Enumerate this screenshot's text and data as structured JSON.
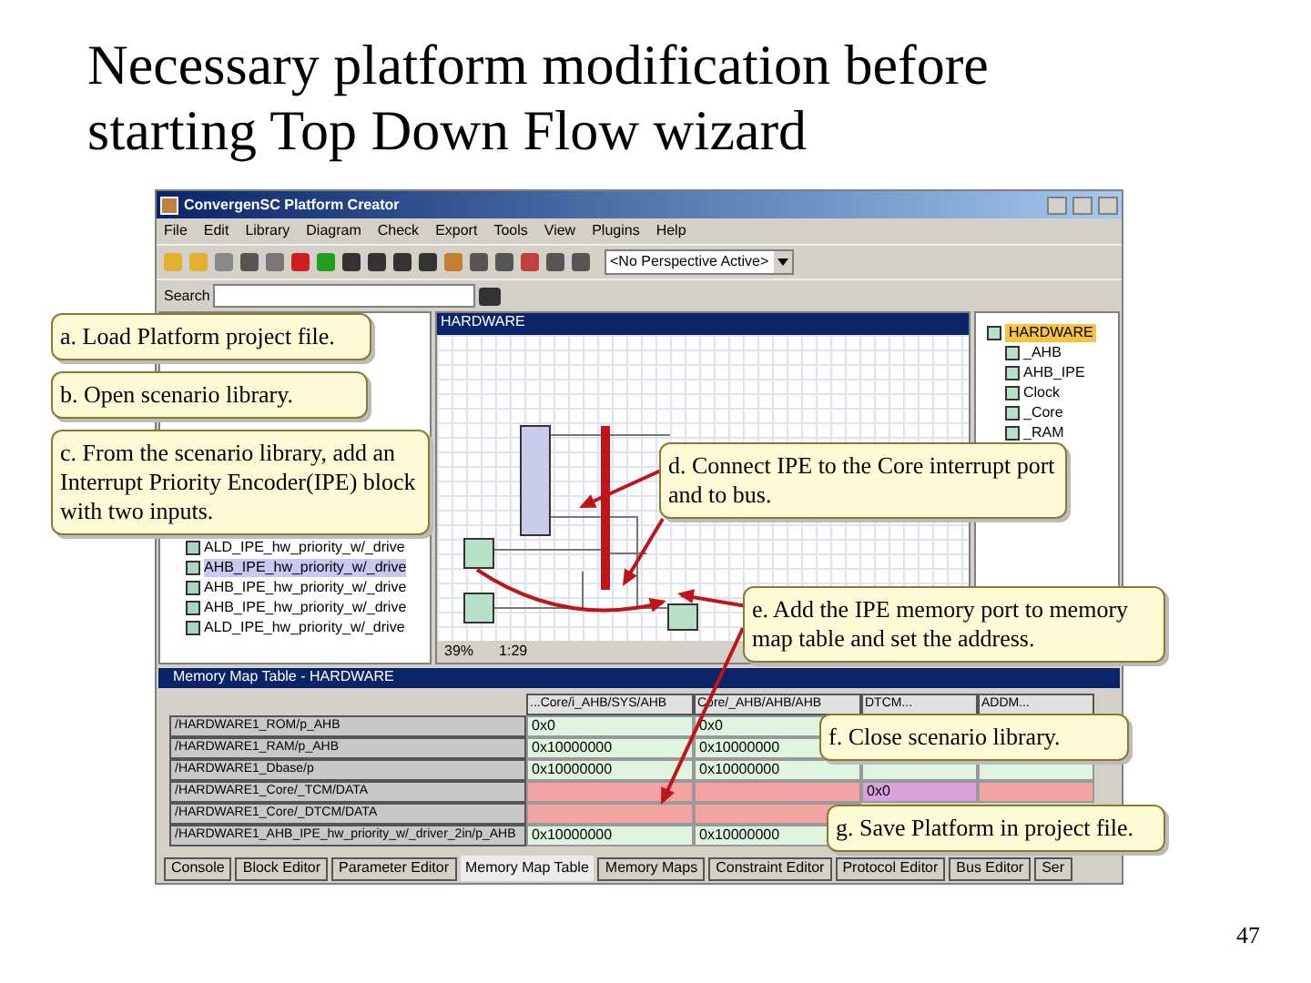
{
  "slide": {
    "title_lines": [
      "Necessary platform modification before",
      "starting Top Down Flow wizard"
    ],
    "page_number": "47"
  },
  "window": {
    "title": "ConvergenSC  Platform Creator",
    "menu": [
      "File",
      "Edit",
      "Library",
      "Diagram",
      "Check",
      "Export",
      "Tools",
      "View",
      "Plugins",
      "Help"
    ],
    "perspective": "<No Perspective Active>",
    "search_label": "Search",
    "library_items": [
      {
        "label": "ALD_IPE_hw_priority_w/_drive",
        "selected": false
      },
      {
        "label": "AHB_IPE_hw_priority_w/_drive",
        "selected": true
      },
      {
        "label": "AHB_IPE_hw_priority_w/_drive",
        "selected": false
      },
      {
        "label": "AHB_IPE_hw_priority_w/_drive",
        "selected": false
      },
      {
        "label": "ALD_IPE_hw_priority_w/_drive",
        "selected": false
      }
    ],
    "canvas": {
      "title": "HARDWARE",
      "zoom": "39%",
      "position": "1:29"
    },
    "hierarchy": {
      "label": "HARDWARE",
      "selected": true,
      "children": [
        {
          "label": "_AHB",
          "selected": false
        },
        {
          "label": "AHB_IPE",
          "selected": false
        },
        {
          "label": "Clock",
          "selected": false
        },
        {
          "label": "_Core",
          "selected": false
        },
        {
          "label": "_RAM",
          "selected": false
        }
      ]
    },
    "memory_map": {
      "title": "Memory Map Table - HARDWARE",
      "columns": [
        "...Core/i_AHB/SYS/AHB",
        "Core/_AHB/AHB/AHB",
        "DTCM...",
        "ADDM..."
      ],
      "rows": [
        {
          "name": "/HARDWARE1_ROM/p_AHB",
          "cells": [
            {
              "text": "0x0",
              "color": "#dff5df"
            },
            {
              "text": "0x0",
              "color": "#dff5df"
            }
          ]
        },
        {
          "name": "/HARDWARE1_RAM/p_AHB",
          "cells": [
            {
              "text": "0x10000000",
              "color": "#dff5df"
            },
            {
              "text": "0x10000000",
              "color": "#dff5df"
            }
          ]
        },
        {
          "name": "/HARDWARE1_Dbase/p",
          "cells": [
            {
              "text": "0x10000000",
              "color": "#dff5df"
            },
            {
              "text": "0x10000000",
              "color": "#dff5df"
            },
            {
              "color": "#dff5df"
            },
            {
              "color": "#dff5df"
            }
          ]
        },
        {
          "name": "/HARDWARE1_Core/_TCM/DATA",
          "cells": [
            {
              "color": "#f4a3a3"
            },
            {
              "color": "#f4a3a3"
            },
            {
              "text": "0x0",
              "color": "#d9a3d9"
            },
            {
              "color": "#f4a3a3"
            }
          ]
        },
        {
          "name": "/HARDWARE1_Core/_DTCM/DATA",
          "cells": [
            {
              "color": "#f4a3a3"
            },
            {
              "color": "#f4a3a3"
            }
          ]
        },
        {
          "name": "/HARDWARE1_AHB_IPE_hw_priority_w/_driver_2in/p_AHB",
          "cells": [
            {
              "text": "0x10000000",
              "color": "#dff5df"
            },
            {
              "text": "0x10000000",
              "color": "#dff5df"
            }
          ]
        }
      ]
    },
    "tabs": [
      {
        "label": "Console",
        "selected": false
      },
      {
        "label": "Block Editor",
        "selected": false
      },
      {
        "label": "Parameter Editor",
        "selected": false
      },
      {
        "label": "Memory Map Table",
        "selected": true
      },
      {
        "label": "Memory Maps",
        "selected": false
      },
      {
        "label": "Constraint Editor",
        "selected": false
      },
      {
        "label": "Protocol Editor",
        "selected": false
      },
      {
        "label": "Bus Editor",
        "selected": false
      },
      {
        "label": "Ser",
        "selected": false
      }
    ]
  },
  "callouts": [
    {
      "text": "a. Load Platform project file."
    },
    {
      "text": "b. Open scenario library."
    },
    {
      "text": "c. From the scenario library, add an Interrupt Priority Encoder(IPE) block with two inputs."
    },
    {
      "text": "d. Connect IPE to the Core interrupt port and to bus."
    },
    {
      "text": "e. Add the IPE memory port to memory map table and set the address."
    },
    {
      "text": "f. Close scenario library."
    },
    {
      "text": "g. Save Platform in project file."
    }
  ]
}
